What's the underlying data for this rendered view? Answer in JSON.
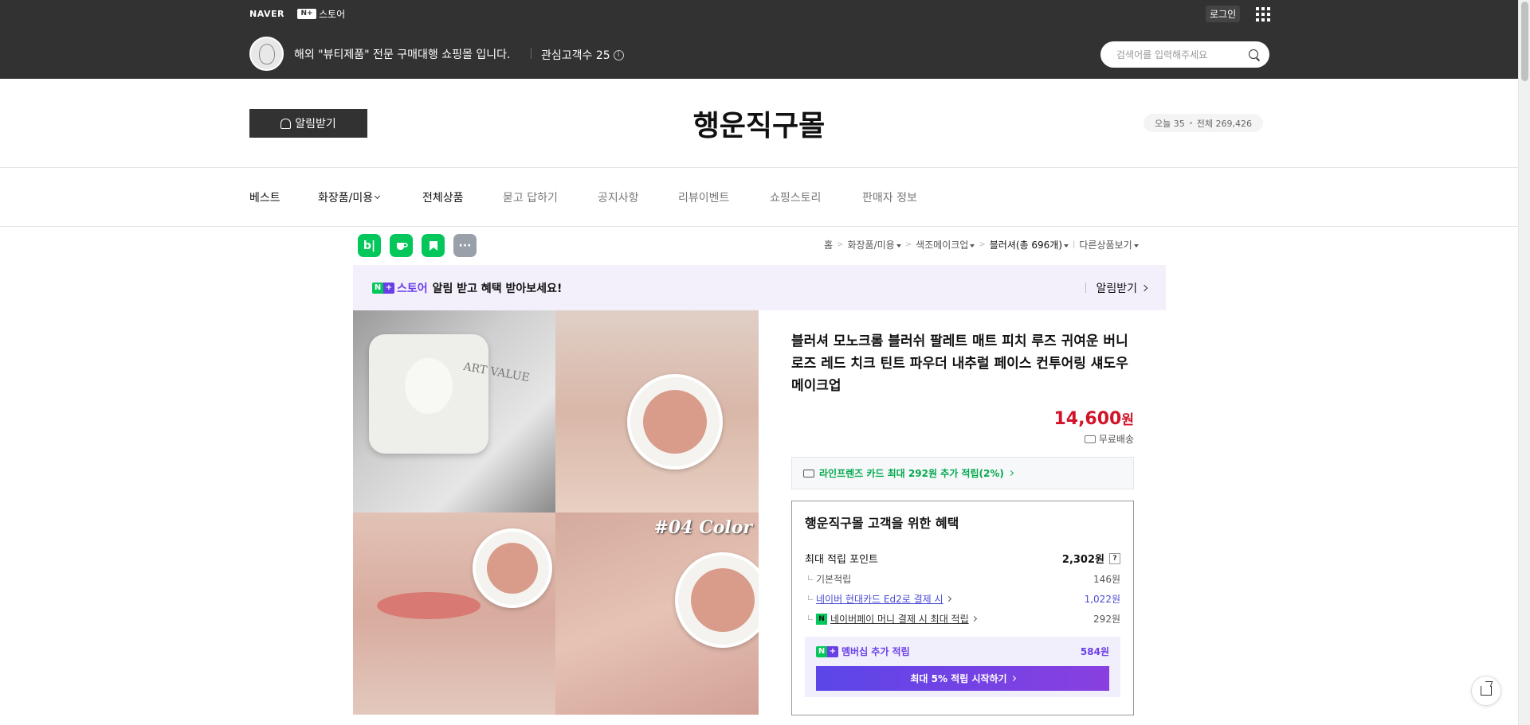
{
  "topbar": {
    "naver_logo": "NAVER",
    "nstore_badge": "N+",
    "nstore_label": "스토어",
    "login": "로그인",
    "store_desc": "해외 \"뷰티제품\" 전문 구매대행 쇼핑몰 입니다.",
    "followers_label": "관심고객수 25",
    "info_glyph": "i",
    "search_placeholder": "검색어를 입력해주세요"
  },
  "header": {
    "notify_button": "알림받기",
    "store_title": "행운직구몰",
    "visitors_today": "오늘 35",
    "visitors_total": "전체 269,426"
  },
  "nav": {
    "items": [
      {
        "label": "베스트"
      },
      {
        "label": "화장품/미용"
      },
      {
        "label": "전체상품"
      },
      {
        "label": "묻고 답하기"
      },
      {
        "label": "공지사항"
      },
      {
        "label": "리뷰이벤트"
      },
      {
        "label": "쇼핑스토리"
      },
      {
        "label": "판매자 정보"
      }
    ]
  },
  "sns": {
    "blog": "b|",
    "more": "···"
  },
  "breadcrumb": {
    "home": "홈",
    "cat1": "화장품/미용",
    "cat2": "색조메이크업",
    "cat3": "블러셔(총 696개)",
    "other": "다른상품보기"
  },
  "banner": {
    "np_n": "N",
    "np_plus": "+",
    "store_word": "스토어",
    "text": "알림 받고 혜택 받아보세요!",
    "action": "알림받기"
  },
  "gallery": {
    "art_value": "ART VALUE",
    "color_label": "#04 Color"
  },
  "product": {
    "title": "블러셔 모노크롬 블러쉬 팔레트 매트 피치 루즈 귀여운 버니 로즈 레드 치크 틴트 파우더 내추럴 페이스 컨투어링 섀도우 메이크업",
    "price": "14,600",
    "price_unit": "원",
    "shipping": "무료배송",
    "card_benefit": "라인프렌즈 카드 최대 292원 추가 적립(2%)"
  },
  "benefit": {
    "title": "행운직구몰 고객을 위한 혜택",
    "max_points_label": "최대 적립 포인트",
    "max_points_value": "2,302원",
    "help": "?",
    "rows": [
      {
        "label": "기본적립",
        "value": "146원"
      },
      {
        "label": "네이버 현대카드 Ed2로 결제 시",
        "value": "1,022원"
      },
      {
        "label": "네이버페이 머니 결제 시 최대 적립",
        "value": "292원"
      }
    ],
    "npay_badge": "N",
    "membership_label": "멤버십 추가 적립",
    "membership_value": "584원",
    "membership_button": "최대 5% 적립 시작하기"
  },
  "colors": {
    "topbar_bg": "#323232",
    "price_red": "#d2142b",
    "naver_green": "#03c75a",
    "purple": "#6b3fe8"
  }
}
